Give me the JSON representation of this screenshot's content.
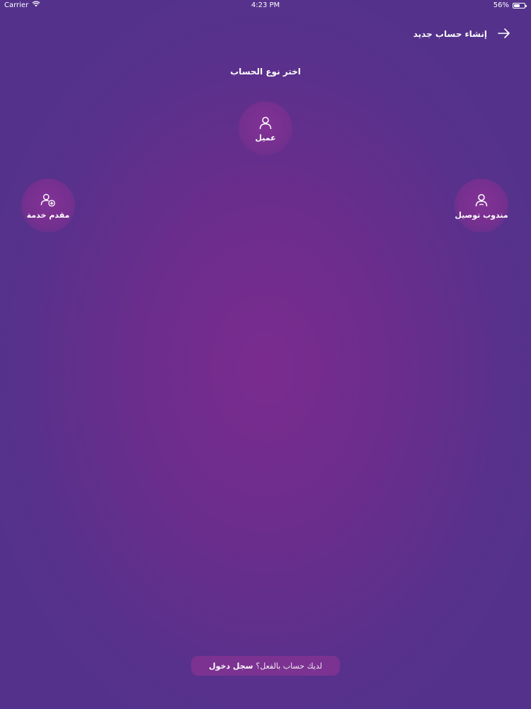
{
  "status_bar": {
    "carrier": "Carrier",
    "time": "4:23 PM",
    "battery_percent_text": "56%",
    "battery_level": 0.56
  },
  "header": {
    "title": "إنشاء حساب جديد",
    "back_icon": "arrow-right-icon"
  },
  "subtitle": "اختر نوع الحساب",
  "roles": {
    "client": {
      "label": "عميل",
      "icon": "user-icon"
    },
    "provider": {
      "label": "مقدم خدمة",
      "icon": "user-plus-icon"
    },
    "delivery": {
      "label": "مندوب توصيل",
      "icon": "user-sad-icon"
    }
  },
  "login": {
    "question": "لديك حساب بالفعل؟",
    "link": "سجل دخول"
  },
  "colors": {
    "background_center": "#7a2c8e",
    "background_edge": "#54328b",
    "button_bg": "#7b3291",
    "text": "#ffffff"
  }
}
